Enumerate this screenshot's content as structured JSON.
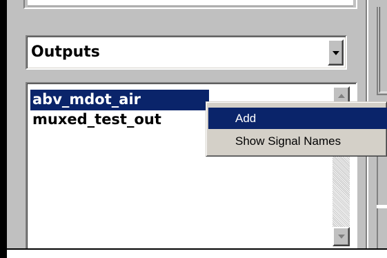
{
  "output_selector": {
    "selected_value": "Outputs",
    "dropdown_icon": "chevron-down-icon"
  },
  "signal_list": {
    "items": [
      {
        "label": "abv_mdot_air",
        "selected": true
      },
      {
        "label": "muxed_test_out",
        "selected": false
      }
    ],
    "scroll_up_icon": "scroll-up-arrow-icon",
    "scroll_down_icon": "scroll-down-arrow-icon"
  },
  "context_menu": {
    "items": [
      {
        "label": "Add",
        "highlighted": true
      },
      {
        "label": "Show Signal Names",
        "highlighted": false
      }
    ]
  },
  "colors": {
    "panel_background": "#c0c0c0",
    "selection_highlight": "#0a246a",
    "selection_text": "#ffffff",
    "menu_background": "#d4d0c8"
  }
}
